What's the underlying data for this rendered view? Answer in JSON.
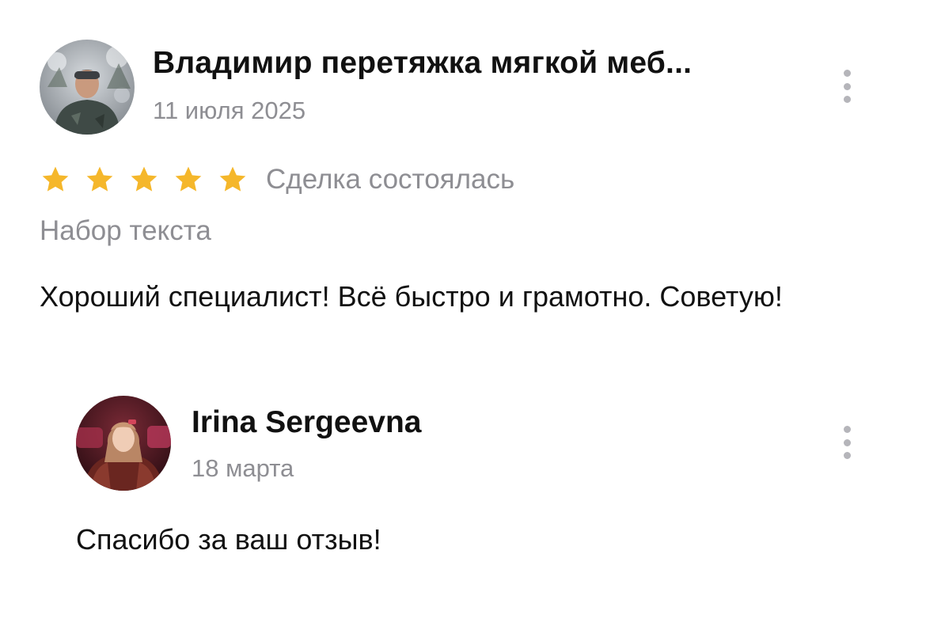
{
  "review": {
    "author_name": "Владимир перетяжка мягкой меб...",
    "date": "11 июля 2025",
    "rating": 5,
    "rating_max": 5,
    "deal_status": "Сделка состоялась",
    "service": "Набор текста",
    "text": "Хороший специалист! Всё быстро и грамотно. Советую!",
    "star_color": "#f5b72b",
    "avatar_icon": "user-photo-man"
  },
  "reply": {
    "author_name": "Irina Sergeevna",
    "date": "18 марта",
    "text": "Спасибо за ваш отзыв!",
    "avatar_icon": "user-photo-woman"
  },
  "icons": {
    "menu": "more-vertical-icon",
    "star": "star-icon"
  },
  "colors": {
    "text_primary": "#111111",
    "text_secondary": "#8e8e93",
    "menu_dots": "#b5b5ba",
    "background": "#ffffff"
  }
}
